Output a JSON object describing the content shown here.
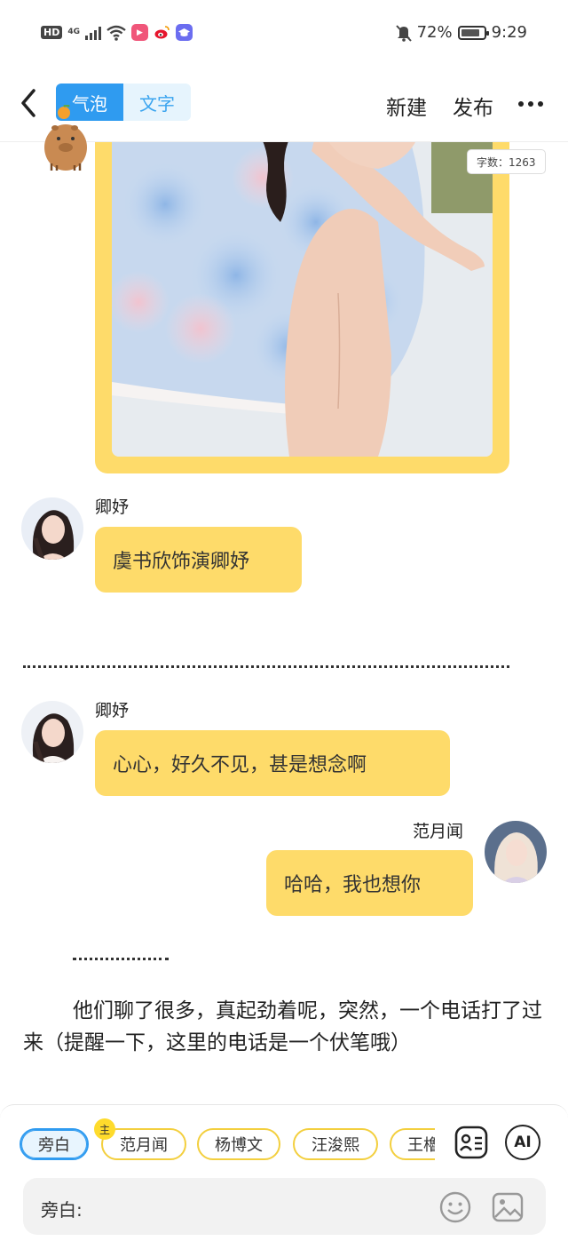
{
  "status_bar": {
    "hd": "HD",
    "network": "4G",
    "battery_percent": "72%",
    "time": "9:29"
  },
  "header": {
    "tab_bubble": "气泡",
    "tab_text": "文字",
    "new_label": "新建",
    "publish_label": "发布"
  },
  "word_count": "字数：1263",
  "messages": [
    {
      "speaker": "卿妤",
      "text": "虞书欣饰演卿妤"
    },
    {
      "speaker": "卿妤",
      "text": "心心，好久不见，甚是想念啊"
    },
    {
      "speaker": "范月闻",
      "text": "哈哈，我也想你"
    }
  ],
  "narration": "他们聊了很多，真起劲着呢，突然，一个电话打了过来（提醒一下，这里的电话是一个伏笔哦）",
  "role_chips": [
    "旁白",
    "范月闻",
    "杨博文",
    "汪浚熙",
    "王櫓"
  ],
  "main_badge": "主",
  "input": {
    "label": "旁白:"
  },
  "ai_label": "AI",
  "colors": {
    "accent": "#2f9bf0",
    "bubble": "#fedb6a",
    "chip_border": "#f3cf3e"
  }
}
